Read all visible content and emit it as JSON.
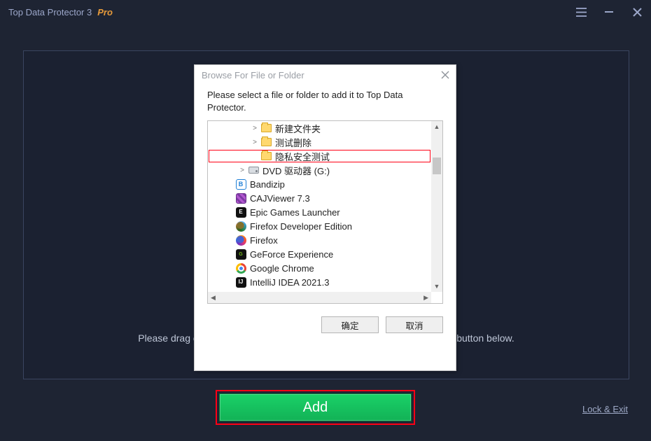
{
  "titlebar": {
    "title": "Top Data Protector 3",
    "edition": "Pro"
  },
  "main": {
    "hint_partial_left": "Please drag or",
    "hint_partial_right": "button below."
  },
  "buttons": {
    "add": "Add",
    "lock_exit": "Lock & Exit"
  },
  "dialog": {
    "title": "Browse For File or Folder",
    "instruction": "Please select a file or folder to add it to Top Data Protector.",
    "ok": "确定",
    "cancel": "取消",
    "tree": [
      {
        "indent": 3,
        "expander": ">",
        "icon": "folder",
        "label": "新建文件夹"
      },
      {
        "indent": 3,
        "expander": ">",
        "icon": "folder",
        "label": "测试删除"
      },
      {
        "indent": 3,
        "expander": "",
        "icon": "folder",
        "label": "隐私安全测试",
        "highlight": true
      },
      {
        "indent": 2,
        "expander": ">",
        "icon": "drive",
        "label": "DVD 驱动器 (G:)"
      },
      {
        "indent": 1,
        "expander": "",
        "icon": "bandizip",
        "label": "Bandizip"
      },
      {
        "indent": 1,
        "expander": "",
        "icon": "caj",
        "label": "CAJViewer 7.3"
      },
      {
        "indent": 1,
        "expander": "",
        "icon": "epic",
        "label": "Epic Games Launcher"
      },
      {
        "indent": 1,
        "expander": "",
        "icon": "ffdev",
        "label": "Firefox Developer Edition"
      },
      {
        "indent": 1,
        "expander": "",
        "icon": "ff",
        "label": "Firefox"
      },
      {
        "indent": 1,
        "expander": "",
        "icon": "nv",
        "label": "GeForce Experience"
      },
      {
        "indent": 1,
        "expander": "",
        "icon": "chrome",
        "label": "Google Chrome"
      },
      {
        "indent": 1,
        "expander": "",
        "icon": "ij",
        "label": "IntelliJ IDEA 2021.3"
      }
    ]
  }
}
